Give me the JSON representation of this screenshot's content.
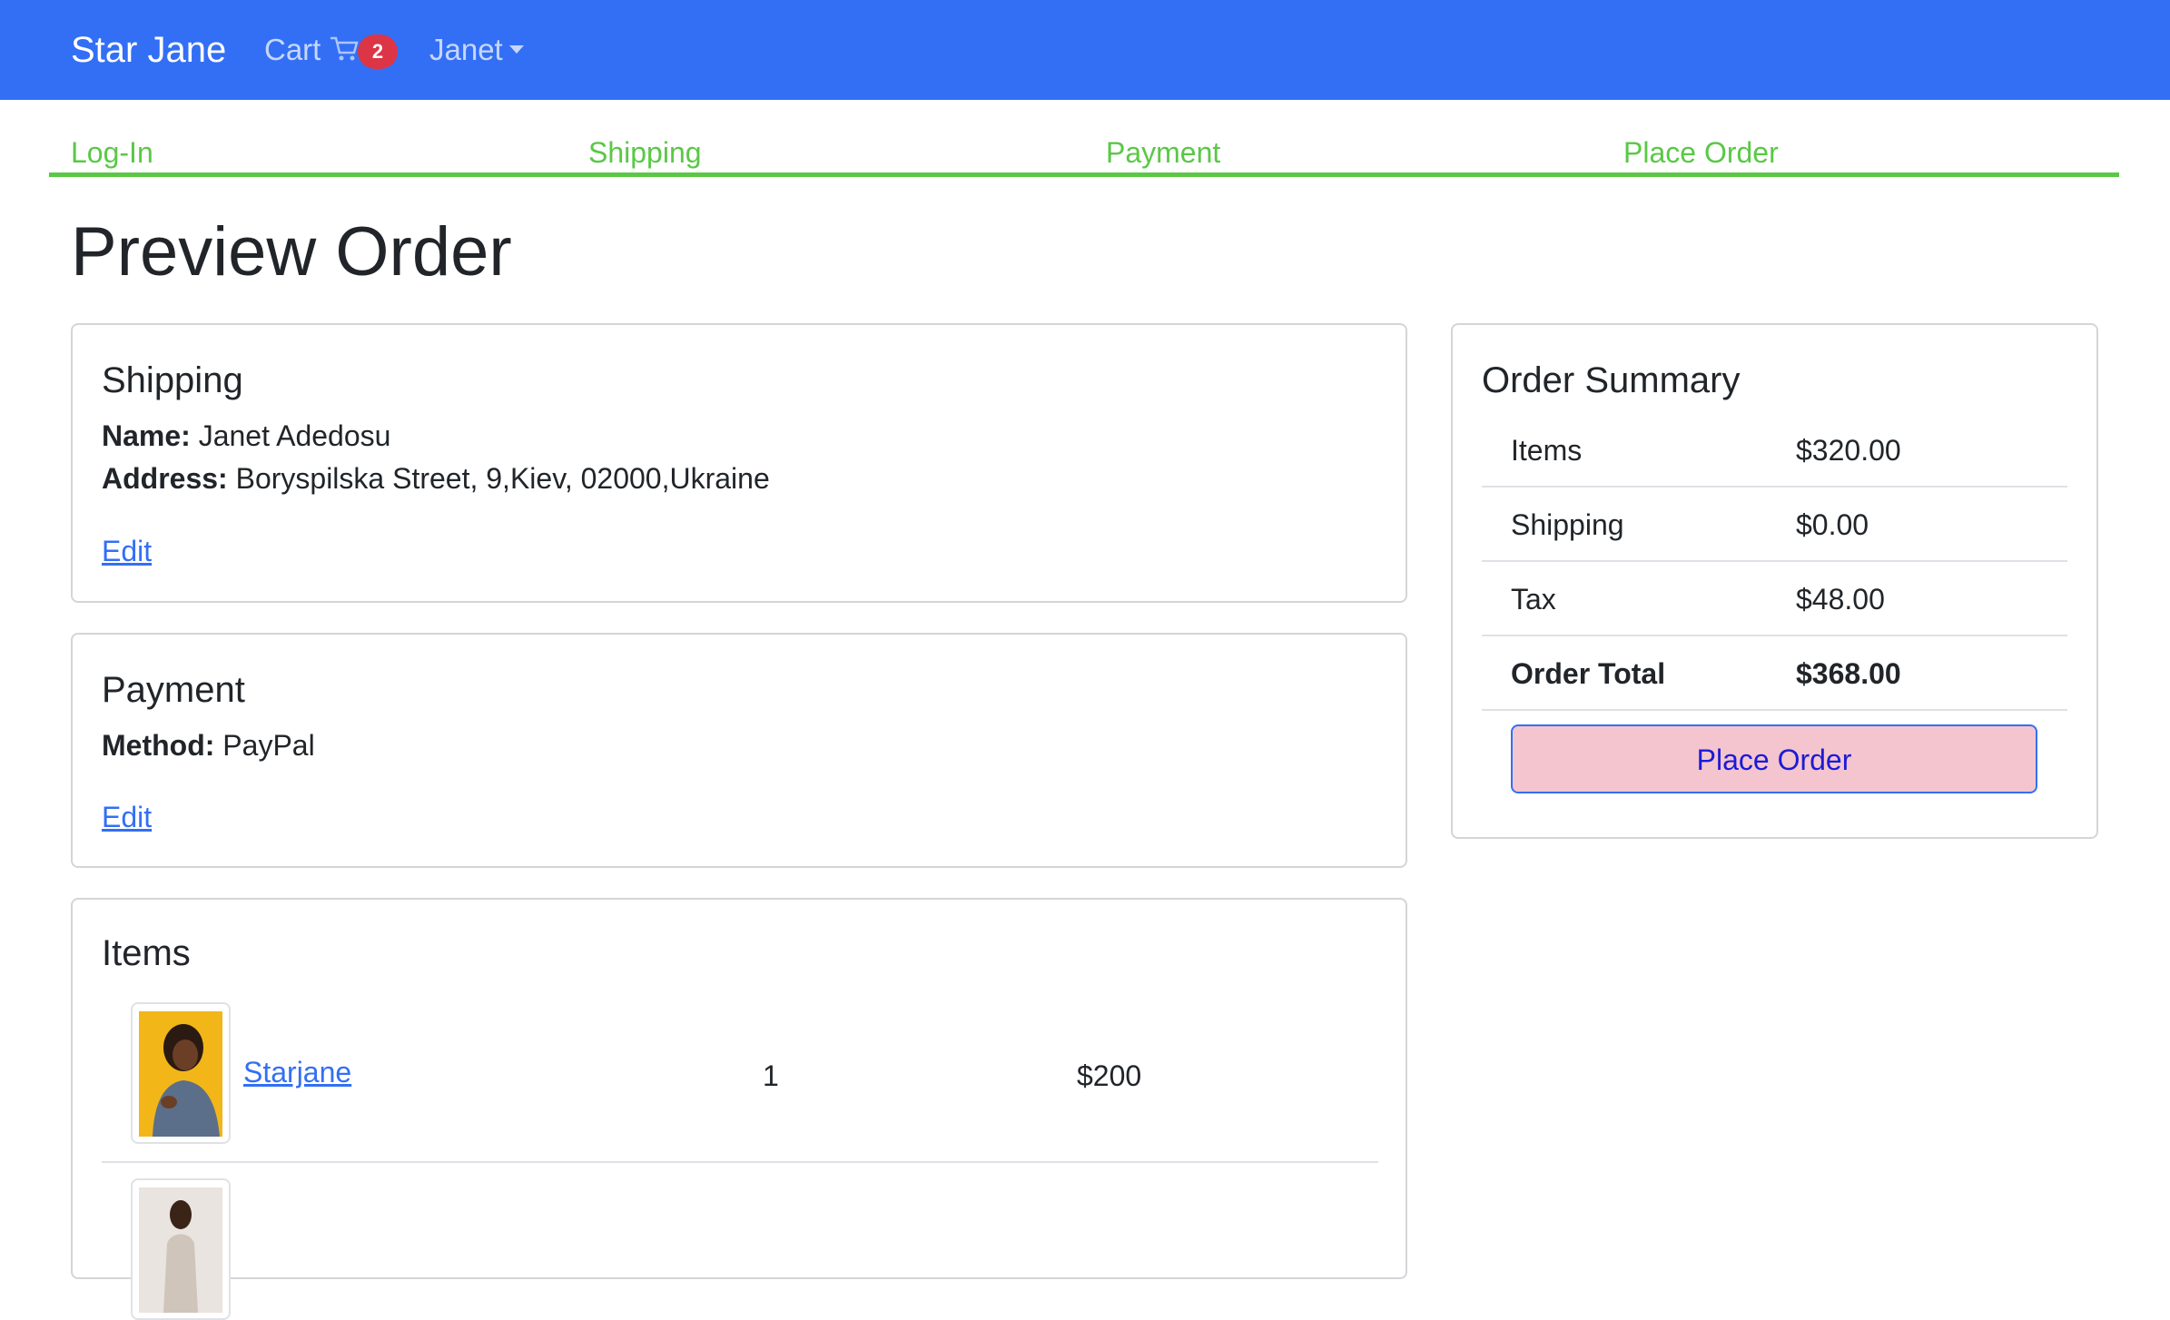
{
  "navbar": {
    "brand": "Star Jane",
    "cart_label": "Cart",
    "cart_count": "2",
    "user_name": "Janet"
  },
  "checkout_steps": [
    "Log-In",
    "Shipping",
    "Payment",
    "Place Order"
  ],
  "colors": {
    "navbar": "#336ff5",
    "steps": "#5ac846",
    "badge": "#dc3545",
    "button_bg": "#f4c5ce"
  },
  "page_title": "Preview Order",
  "shipping": {
    "title": "Shipping",
    "name_label": "Name:",
    "name_value": "Janet Adedosu",
    "address_label": "Address:",
    "address_value": "Boryspilska Street, 9,Kiev, 02000,Ukraine",
    "edit_label": "Edit"
  },
  "payment": {
    "title": "Payment",
    "method_label": "Method:",
    "method_value": "PayPal",
    "edit_label": "Edit"
  },
  "items": {
    "title": "Items",
    "rows": [
      {
        "name": "Starjane",
        "quantity": "1",
        "price": "$200"
      }
    ]
  },
  "summary": {
    "title": "Order Summary",
    "items_label": "Items",
    "items_value": "$320.00",
    "shipping_label": "Shipping",
    "shipping_value": "$0.00",
    "tax_label": "Tax",
    "tax_value": "$48.00",
    "total_label": "Order Total",
    "total_value": "$368.00",
    "button_label": "Place Order"
  }
}
